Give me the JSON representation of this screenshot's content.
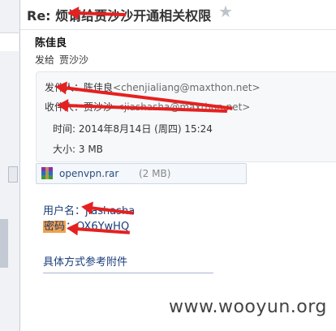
{
  "email": {
    "subject": "Re: 烦请给贾沙沙开通相关权限",
    "sender": "陈佳良",
    "to_label": "发给",
    "to_name": "贾沙沙"
  },
  "header": {
    "from_label": "发件人：",
    "from_name": "陈佳良",
    "from_email": "<chenjialiang@maxthon.net>",
    "to_label": "收件人：",
    "to_name": "贾沙沙",
    "to_email": "<jiashasha@maxthon.net>",
    "time_label": "时间:",
    "time_value": "2014年8月14日 (周四) 15:24",
    "size_label": "大小:",
    "size_value": "3 MB"
  },
  "attachment": {
    "name": "openvpn.rar",
    "size": "(2 MB)"
  },
  "body": {
    "user_label": "用户名：",
    "user_value": "jiashasha",
    "pw_label": "密码",
    "pw_value": "：OX6YwHQ",
    "link_text": "具体方式参考附件"
  },
  "watermark": "www.wooyun.org",
  "colors": {
    "annotation_arrow": "#e52020",
    "highlight": "#f3a04a",
    "body_text": "#1a3d78"
  }
}
